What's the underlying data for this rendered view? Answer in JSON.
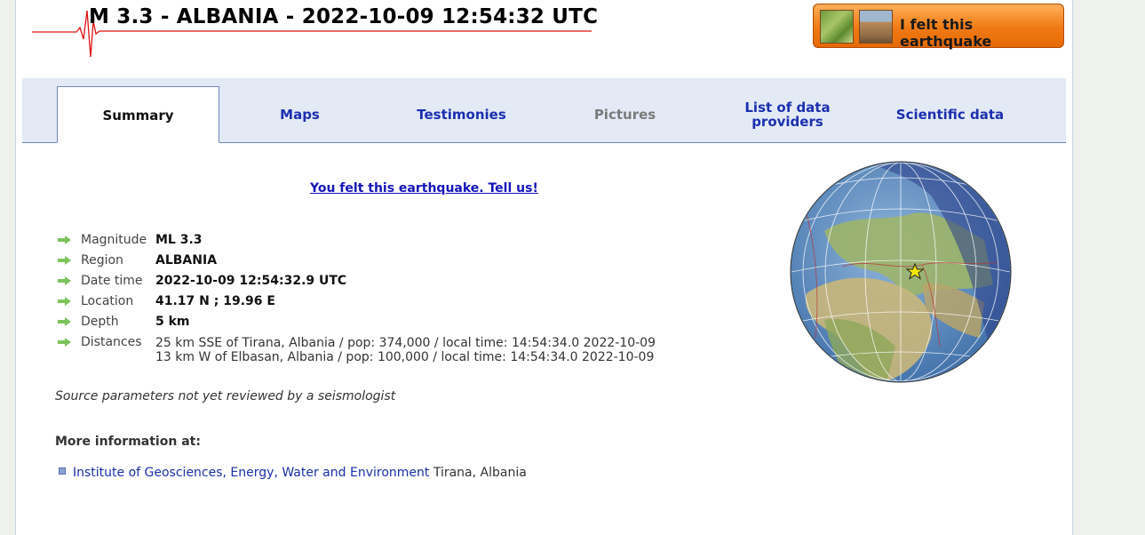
{
  "header": {
    "title": "M 3.3 - ALBANIA - 2022-10-09 12:54:32 UTC",
    "felt_button_label": "I felt this earthquake"
  },
  "tabs": [
    {
      "label": "Summary",
      "state": "active"
    },
    {
      "label": "Maps",
      "state": "normal"
    },
    {
      "label": "Testimonies",
      "state": "normal"
    },
    {
      "label": "Pictures",
      "state": "disabled"
    },
    {
      "label": "List of data providers",
      "state": "normal"
    },
    {
      "label": "Scientific data",
      "state": "normal"
    }
  ],
  "summary": {
    "tell_us_link": "You felt this earthquake. Tell us!",
    "fields": {
      "magnitude": {
        "label": "Magnitude",
        "value": "ML 3.3"
      },
      "region": {
        "label": "Region",
        "value": "ALBANIA"
      },
      "datetime": {
        "label": "Date time",
        "value": "2022-10-09 12:54:32.9 UTC"
      },
      "location": {
        "label": "Location",
        "value": "41.17 N ; 19.96 E"
      },
      "depth": {
        "label": "Depth",
        "value": "5 km"
      },
      "distances": {
        "label": "Distances",
        "lines": [
          "25 km SSE of Tirana, Albania / pop: 374,000 / local time: 14:54:34.0 2022-10-09",
          "13 km W of Elbasan, Albania / pop: 100,000 / local time: 14:54:34.0 2022-10-09"
        ]
      }
    },
    "review_note": "Source parameters not yet reviewed by a seismologist",
    "more_info_heading": "More information at:",
    "institution": {
      "name": "Institute of Geosciences, Energy, Water and Environment",
      "location": " Tirana, Albania"
    }
  },
  "colors": {
    "tab_link": "#1b2fb0",
    "tab_bar": "#e3eaf6",
    "felt_button": "#f07a14",
    "seismogram": "#e01010"
  },
  "icons": {
    "header_logo": "seismogram-icon",
    "field_bullet": "green-arrow-icon",
    "epicenter_marker": "star-icon"
  }
}
